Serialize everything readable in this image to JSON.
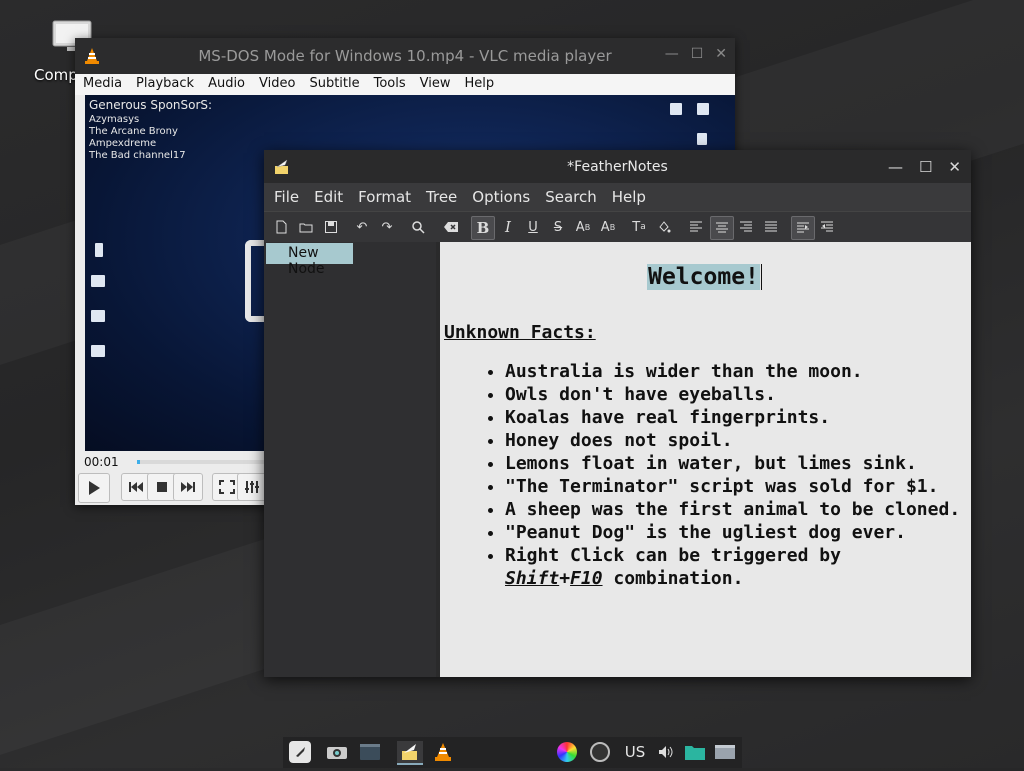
{
  "desktop": {
    "icon_label": "Comp"
  },
  "vlc": {
    "title": "MS-DOS Mode for Windows 10.mp4 - VLC media player",
    "menu": [
      "Media",
      "Playback",
      "Audio",
      "Video",
      "Subtitle",
      "Tools",
      "View",
      "Help"
    ],
    "sponsors_heading": "Generous SponSorS:",
    "sponsors": [
      "Azymasys",
      "The Arcane Brony",
      "Ampexdreme",
      "The Bad channel17"
    ],
    "elapsed": "00:01",
    "progress_fraction": 0.005
  },
  "feathernotes": {
    "title": "*FeatherNotes",
    "menu": [
      "File",
      "Edit",
      "Format",
      "Tree",
      "Options",
      "Search",
      "Help"
    ],
    "tree_node": "New Node",
    "document": {
      "welcome": "Welcome!",
      "heading": "Unknown Facts:",
      "facts": [
        "Australia is wider than the moon.",
        "Owls don't have eyeballs.",
        "Koalas have real fingerprints.",
        "Honey does not spoil.",
        "Lemons float in water, but limes sink.",
        "\"The Terminator\" script was sold for $1.",
        "A sheep was the first animal to be cloned.",
        "\"Peanut Dog\" is the ugliest dog ever."
      ],
      "last_fact_prefix": "Right Click can be triggered by",
      "last_fact_key1": "Shift",
      "last_fact_plus": "+",
      "last_fact_key2": "F10",
      "last_fact_suffix": " combination."
    }
  },
  "taskbar": {
    "keyboard_layout": "US"
  }
}
